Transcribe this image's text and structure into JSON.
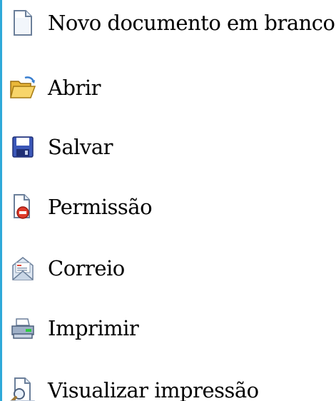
{
  "menu": {
    "items": [
      {
        "label": "Novo documento em branco",
        "icon": "blank-document-icon"
      },
      {
        "label": "Abrir",
        "icon": "open-folder-icon"
      },
      {
        "label": "Salvar",
        "icon": "floppy-disk-icon"
      },
      {
        "label": "Permissão",
        "icon": "permission-document-icon"
      },
      {
        "label": "Correio",
        "icon": "mail-envelope-icon"
      },
      {
        "label": "Imprimir",
        "icon": "printer-icon"
      },
      {
        "label": "Visualizar impressão",
        "icon": "print-preview-icon"
      }
    ]
  },
  "colors": {
    "accent_bar": "#2fa9d9",
    "text": "#000000"
  }
}
